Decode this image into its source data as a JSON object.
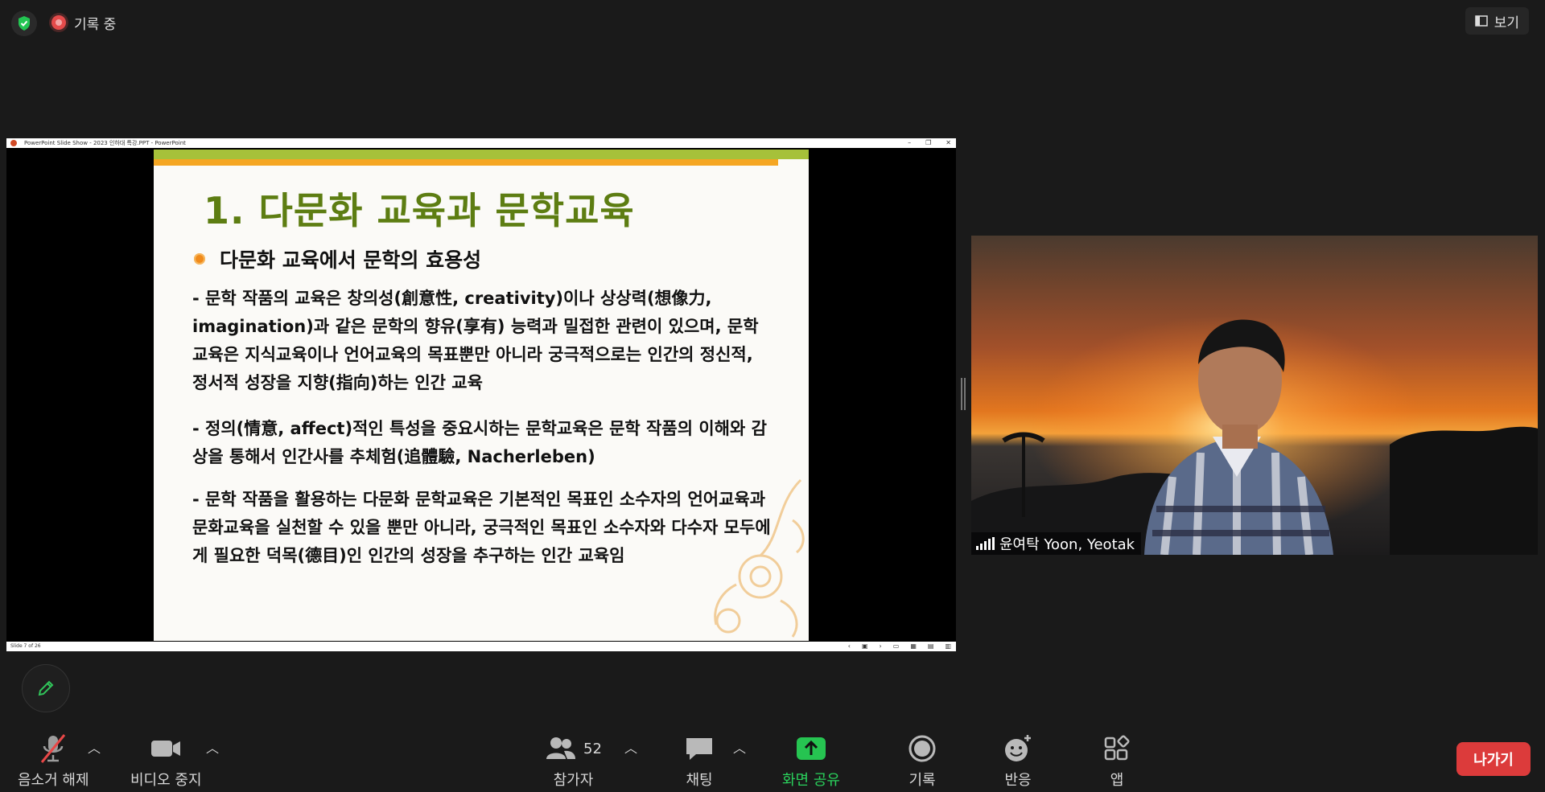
{
  "top": {
    "recording_label": "기록 중",
    "view_label": "보기"
  },
  "ppt": {
    "window_title": "PowerPoint Slide Show  -  2023 인하대 특강.PPT  -  PowerPoint",
    "status_slide": "Slide 7 of 26",
    "slide": {
      "title": "1. 다문화 교육과 문학교육",
      "subtitle": "다문화 교육에서 문학의 효용성",
      "para1": "- 문학 작품의 교육은 창의성(創意性, creativity)이나 상상력(想像力, imagination)과 같은 문학의 향유(享有) 능력과 밀접한 관련이 있으며, 문학교육은 지식교육이나 언어교육의 목표뿐만 아니라 궁극적으로는 인간의 정신적, 정서적 성장을 지향(指向)하는 인간 교육",
      "para2": "- 정의(情意, affect)적인 특성을 중요시하는 문학교육은 문학 작품의 이해와 감상을 통해서 인간사를 추체험(追體驗, Nacherleben)",
      "para3": "- 문학 작품을 활용하는 다문화 문학교육은 기본적인 목표인 소수자의 언어교육과 문화교육을 실천할 수 있을 뿐만 아니라, 궁극적인 목표인 소수자와 다수자 모두에게 필요한 덕목(德目)인 인간의 성장을 추구하는 인간 교육임"
    }
  },
  "video": {
    "participant_name": "윤여탁 Yoon,   Yeotak"
  },
  "toolbar": {
    "mute_label": "음소거 해제",
    "video_label": "비디오 중지",
    "participants_label": "참가자",
    "participants_count": "52",
    "chat_label": "채팅",
    "share_label": "화면 공유",
    "record_label": "기록",
    "reactions_label": "반응",
    "apps_label": "앱",
    "leave_label": "나가기"
  },
  "colors": {
    "share_green": "#26c451",
    "leave_red": "#dc3b3b",
    "slide_title_green": "#5d7d12"
  }
}
